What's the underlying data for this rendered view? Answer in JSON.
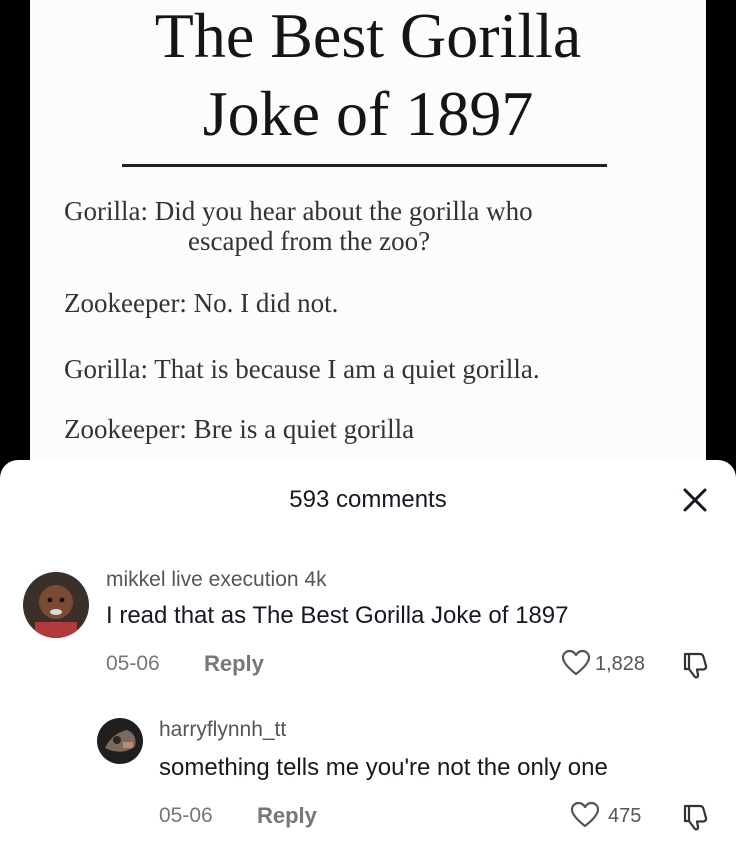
{
  "meme": {
    "title_line1": "The Best Gorilla",
    "title_line2": "Joke of 1897",
    "lines": [
      "Gorilla: Did you hear about the gorilla who",
      "escaped from the zoo?",
      "Zookeeper: No. I did not.",
      "Gorilla: That is because I am a quiet gorilla.",
      "Zookeeper: Bre is a quiet gorilla"
    ]
  },
  "comments_panel": {
    "count_label": "593 comments",
    "comments": [
      {
        "username": "mikkel live execution 4k",
        "text": "I read that as The Best Gorilla Joke of 1897",
        "date": "05-06",
        "reply_label": "Reply",
        "likes": "1,828"
      },
      {
        "username": "harryflynnh_tt",
        "text": "something tells me you're not the only one",
        "date": "05-06",
        "reply_label": "Reply",
        "likes": "475"
      }
    ]
  },
  "colors": {
    "sheet_bg": "#ffffff",
    "text_primary": "#161823",
    "text_secondary": "#777777",
    "backdrop": "#000000"
  },
  "icons": [
    "close-icon",
    "heart-icon",
    "dislike-icon",
    "avatar"
  ]
}
